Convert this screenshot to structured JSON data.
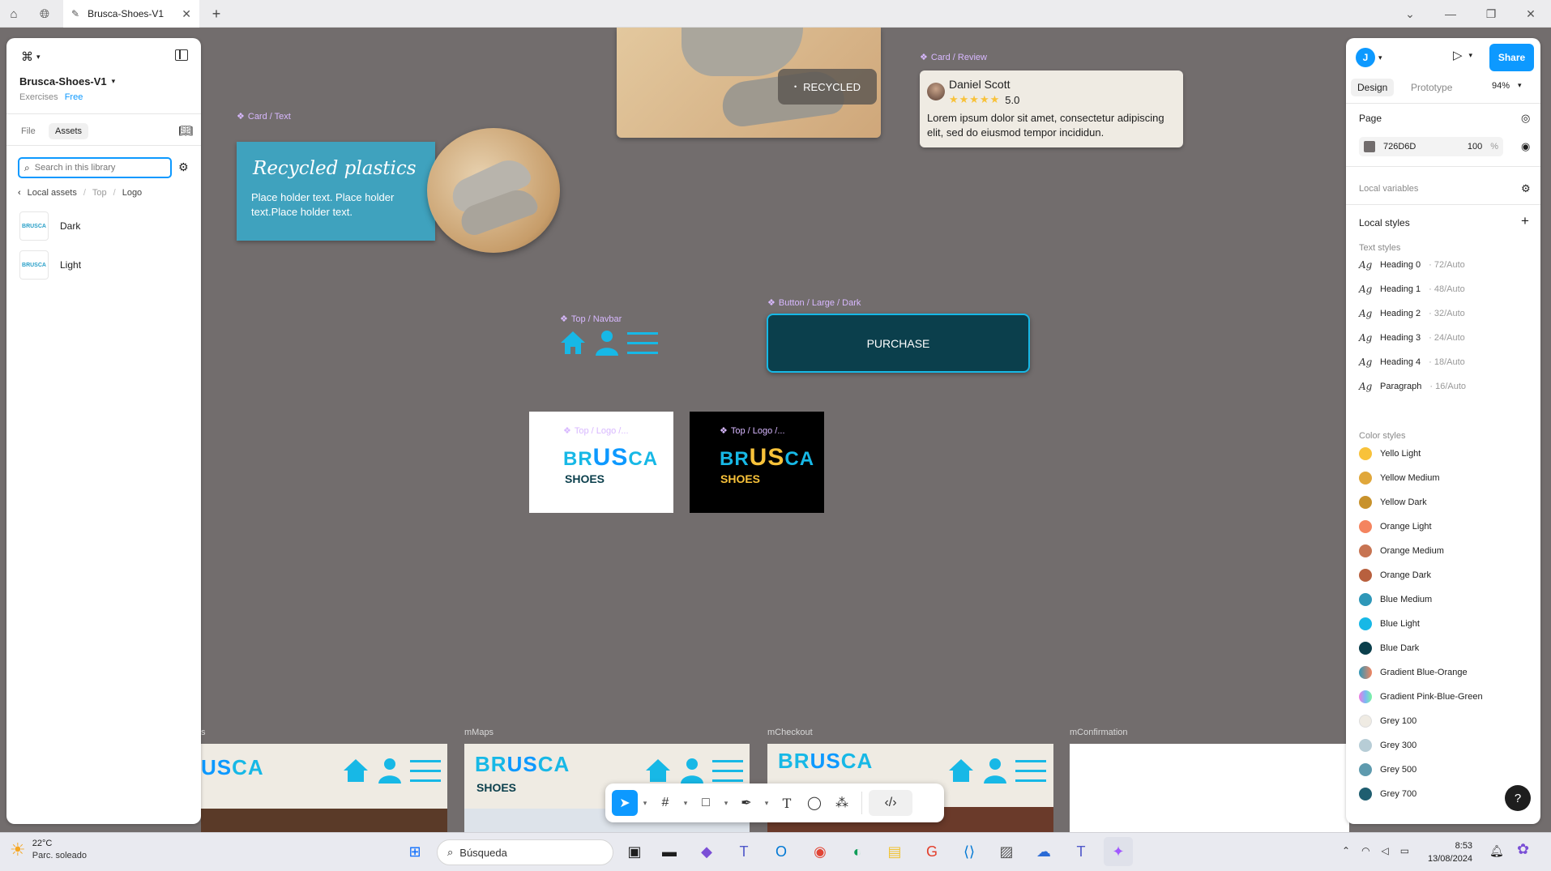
{
  "window": {
    "tab_title": "Brusca-Shoes-V1"
  },
  "left_panel": {
    "file_name": "Brusca-Shoes-V1",
    "team": "Exercises",
    "plan": "Free",
    "tab_file": "File",
    "tab_assets": "Assets",
    "search_placeholder": "Search in this library",
    "breadcrumb": {
      "root": "Local assets",
      "sep1": "/",
      "mid": "Top",
      "sep2": "/",
      "leaf": "Logo"
    },
    "assets": [
      {
        "label": "Dark"
      },
      {
        "label": "Light"
      }
    ]
  },
  "canvas": {
    "card_text_label": "Card / Text",
    "card_text_title": "Recycled plastics",
    "card_text_body": "Place holder text. Place holder text.Place holder text.",
    "recycled_badge": "RECYCLED",
    "review_label": "Card / Review",
    "review_name": "Daniel Scott",
    "review_stars": "★★★★★",
    "review_rating": "5.0",
    "review_text": "Lorem ipsum dolor sit amet, consectetur adipiscing elit, sed do eiusmod tempor incididun.",
    "navbar_label": "Top / Navbar",
    "button_label": "Button / Large / Dark",
    "button_text": "PURCHASE",
    "logo_light_label": "Top / Logo /...",
    "logo_dark_label": "Top / Logo /...",
    "logo_word_a": "BR",
    "logo_word_b": "US",
    "logo_word_c": "CA",
    "logo_sub": "SHOES",
    "frame_labels": [
      "s",
      "mMaps",
      "mCheckout",
      "mConfirmation"
    ]
  },
  "right_panel": {
    "avatar": "J",
    "share": "Share",
    "tab_design": "Design",
    "tab_prototype": "Prototype",
    "zoom": "94%",
    "page_heading": "Page",
    "page_color": "726D6D",
    "page_opacity": "100",
    "page_opacity_unit": "%",
    "local_variables": "Local variables",
    "local_styles": "Local styles",
    "text_styles_heading": "Text styles",
    "text_styles": [
      {
        "name": "Heading 0",
        "meta": "· 72/Auto"
      },
      {
        "name": "Heading 1",
        "meta": "· 48/Auto"
      },
      {
        "name": "Heading 2",
        "meta": "· 32/Auto"
      },
      {
        "name": "Heading 3",
        "meta": "· 24/Auto"
      },
      {
        "name": "Heading 4",
        "meta": "· 18/Auto"
      },
      {
        "name": "Paragraph",
        "meta": "· 16/Auto"
      }
    ],
    "color_styles_heading": "Color styles",
    "color_styles": [
      {
        "name": "Yello Light",
        "color": "#F8C23A"
      },
      {
        "name": "Yellow Medium",
        "color": "#E0A73B"
      },
      {
        "name": "Yellow Dark",
        "color": "#C8922C"
      },
      {
        "name": "Orange Light",
        "color": "#F4845F"
      },
      {
        "name": "Orange Medium",
        "color": "#C77452"
      },
      {
        "name": "Orange Dark",
        "color": "#B8603E"
      },
      {
        "name": "Blue Medium",
        "color": "#2E97B8"
      },
      {
        "name": "Blue Light",
        "color": "#17B8E6"
      },
      {
        "name": "Blue Dark",
        "color": "#0B3F4C"
      },
      {
        "name": "Gradient Blue-Orange",
        "color": "linear-gradient(90deg,#2E97B8,#F4845F)"
      },
      {
        "name": "Gradient Pink-Blue-Green",
        "color": "linear-gradient(90deg,#F07AE0,#7AB8F5,#7AF5A0)"
      },
      {
        "name": "Grey 100",
        "color": "#EFEBE3"
      },
      {
        "name": "Grey 300",
        "color": "#B7CDD6"
      },
      {
        "name": "Grey 500",
        "color": "#5E9AAE"
      },
      {
        "name": "Grey 700",
        "color": "#1F5E70"
      }
    ]
  },
  "taskbar": {
    "weather_temp": "22°C",
    "weather_desc": "Parc. soleado",
    "search_text": "Búsqueda",
    "time": "8:53",
    "date": "13/08/2024"
  },
  "colors": {
    "canvas": "#726D6D",
    "accent": "#0d99ff",
    "card_blue": "#3FA2BE",
    "button_dark": "#0B3F4C",
    "brand_blue": "#17B8E6"
  }
}
